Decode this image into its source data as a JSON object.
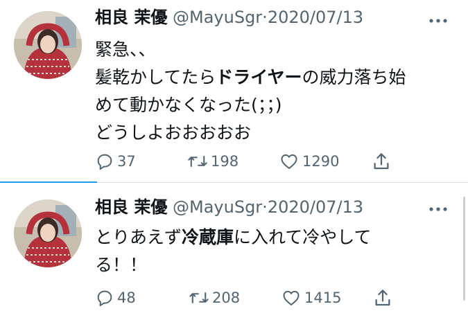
{
  "tweets": [
    {
      "name": "相良 茉優",
      "handle": "@MayuSgr",
      "separator": "·",
      "date": "2020/07/13",
      "lines": [
        [
          {
            "t": "緊急、、",
            "b": false
          }
        ],
        [
          {
            "t": "髪乾かしてたら",
            "b": false
          },
          {
            "t": "ドライヤー",
            "b": true
          },
          {
            "t": "の威力落ち始",
            "b": false
          }
        ],
        [
          {
            "t": "めて動かなくなった(；；)",
            "b": false
          }
        ],
        [
          {
            "t": "どうしよおおおおお",
            "b": false
          }
        ]
      ],
      "replies": "37",
      "retweets": "198",
      "likes": "1290"
    },
    {
      "name": "相良 茉優",
      "handle": "@MayuSgr",
      "separator": "·",
      "date": "2020/07/13",
      "lines": [
        [
          {
            "t": "とりあえず",
            "b": false
          },
          {
            "t": "冷蔵庫",
            "b": true
          },
          {
            "t": "に入れて冷やして",
            "b": false
          }
        ],
        [
          {
            "t": "る！！",
            "b": false
          }
        ]
      ],
      "replies": "48",
      "retweets": "208",
      "likes": "1415"
    }
  ],
  "icons": [
    "avatar",
    "more-icon",
    "reply-icon",
    "retweet-icon",
    "like-icon",
    "share-icon"
  ],
  "colors": {
    "accent": "#1d9bf0",
    "muted": "#536471",
    "text": "#0f1419"
  }
}
